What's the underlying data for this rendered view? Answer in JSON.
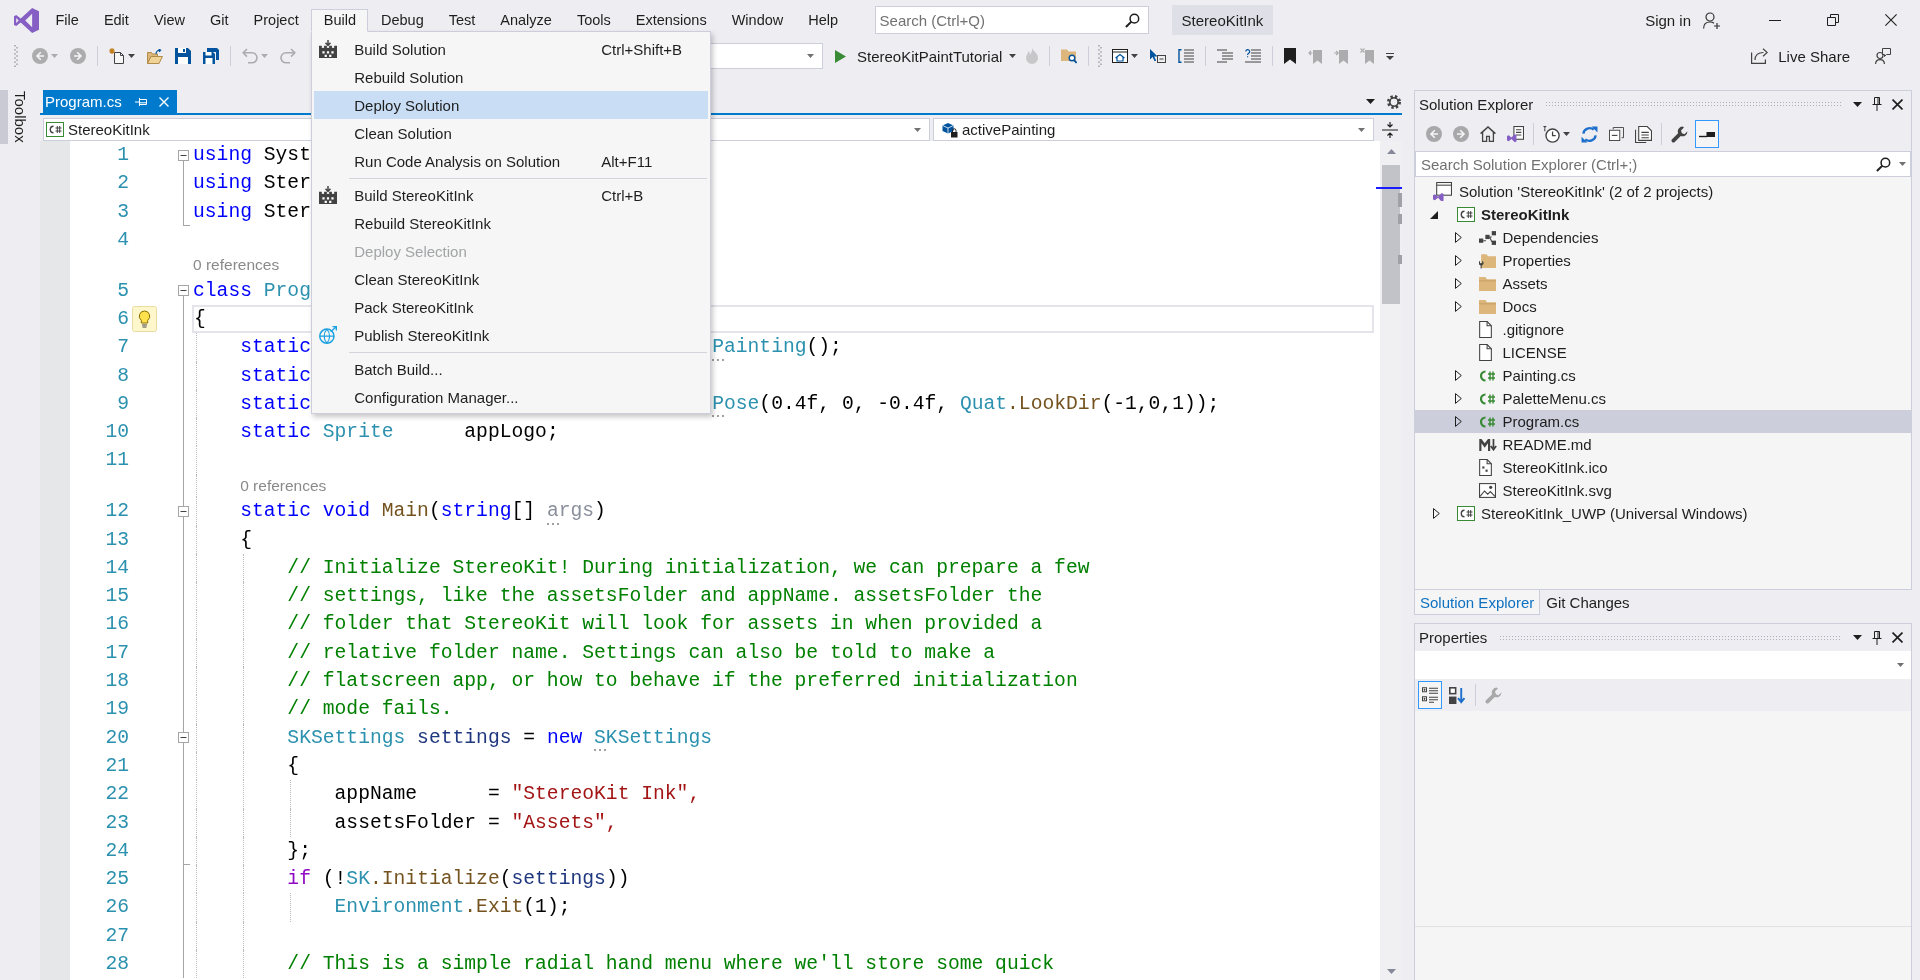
{
  "title_bar": {
    "menu": [
      {
        "label": "File",
        "selected": false
      },
      {
        "label": "Edit",
        "selected": false
      },
      {
        "label": "View",
        "selected": false
      },
      {
        "label": "Git",
        "selected": false
      },
      {
        "label": "Project",
        "selected": false
      },
      {
        "label": "Build",
        "selected": true
      },
      {
        "label": "Debug",
        "selected": false
      },
      {
        "label": "Test",
        "selected": false
      },
      {
        "label": "Analyze",
        "selected": false
      },
      {
        "label": "Tools",
        "selected": false
      },
      {
        "label": "Extensions",
        "selected": false
      },
      {
        "label": "Window",
        "selected": false
      },
      {
        "label": "Help",
        "selected": false
      }
    ],
    "search": {
      "placeholder": "Search (Ctrl+Q)"
    },
    "solution_name": "StereoKitInk",
    "sign_in": "Sign in"
  },
  "build_menu": {
    "items": [
      {
        "kind": "item",
        "label": "Build Solution",
        "shortcut": "Ctrl+Shift+B",
        "selected": false,
        "disabled": false
      },
      {
        "kind": "item",
        "label": "Rebuild Solution",
        "selected": false,
        "disabled": false
      },
      {
        "kind": "item",
        "label": "Deploy Solution",
        "selected": true,
        "disabled": false
      },
      {
        "kind": "item",
        "label": "Clean Solution",
        "selected": false,
        "disabled": false
      },
      {
        "kind": "item",
        "label": "Run Code Analysis on Solution",
        "shortcut": "Alt+F11",
        "selected": false,
        "disabled": false
      },
      {
        "kind": "separator"
      },
      {
        "kind": "item",
        "label": "Build StereoKitInk",
        "shortcut": "Ctrl+B",
        "selected": false,
        "disabled": false
      },
      {
        "kind": "item",
        "label": "Rebuild StereoKitInk",
        "selected": false,
        "disabled": false
      },
      {
        "kind": "item",
        "label": "Deploy Selection",
        "selected": false,
        "disabled": true
      },
      {
        "kind": "item",
        "label": "Clean StereoKitInk",
        "selected": false,
        "disabled": false
      },
      {
        "kind": "item",
        "label": "Pack StereoKitInk",
        "selected": false,
        "disabled": false
      },
      {
        "kind": "item",
        "label": "Publish StereoKitInk",
        "selected": false,
        "disabled": false
      },
      {
        "kind": "separator"
      },
      {
        "kind": "item",
        "label": "Batch Build...",
        "selected": false,
        "disabled": false
      },
      {
        "kind": "item",
        "label": "Configuration Manager...",
        "selected": false,
        "disabled": false
      }
    ]
  },
  "toolbar": {
    "left_buttons": [
      {
        "disabled": true
      },
      {
        "disabled": true
      },
      {
        "disabled": false
      },
      {
        "disabled": false
      },
      {
        "disabled": false
      },
      {
        "disabled": false
      },
      {
        "disabled": true
      },
      {
        "disabled": true
      }
    ],
    "start": {
      "label": "StereoKitPaintTutorial"
    },
    "right_buttons": [
      {
        "disabled": true
      },
      {
        "disabled": false
      },
      {
        "disabled": false
      },
      {
        "disabled": false
      },
      {
        "disabled": false
      },
      {
        "disabled": false
      },
      {
        "disabled": false
      },
      {
        "disabled": false
      },
      {
        "disabled": true
      },
      {
        "disabled": true
      },
      {
        "disabled": true
      },
      {
        "disabled": false
      }
    ],
    "live_share": "Live Share"
  },
  "toolbox": {
    "label": "Toolbox"
  },
  "editor": {
    "tabs": [
      {
        "label": "Program.cs",
        "selected": true
      }
    ],
    "navigation": {
      "project": "StereoKitInk",
      "member": "activePainting"
    },
    "rows": [
      {
        "kind": "code",
        "number": "1",
        "fold_start": true,
        "fold_end": false,
        "lightbulb": false,
        "current": false,
        "tokens": [
          {
            "kind": "keyword",
            "text": "using"
          },
          {
            "kind": "plain",
            "text": " Syst"
          }
        ]
      },
      {
        "kind": "code",
        "number": "2",
        "fold_start": false,
        "fold_end": false,
        "lightbulb": false,
        "current": false,
        "tokens": [
          {
            "kind": "keyword",
            "text": "using"
          },
          {
            "kind": "plain",
            "text": " Ster"
          }
        ]
      },
      {
        "kind": "code",
        "number": "3",
        "fold_start": false,
        "fold_end": true,
        "lightbulb": false,
        "current": false,
        "tokens": [
          {
            "kind": "keyword",
            "text": "using"
          },
          {
            "kind": "plain",
            "text": " Ster"
          }
        ]
      },
      {
        "kind": "code",
        "number": "4",
        "fold_start": false,
        "fold_end": false,
        "lightbulb": false,
        "current": false
      },
      {
        "kind": "codelens",
        "fold_start": false,
        "fold_end": false,
        "lightbulb": false,
        "text": "0 references"
      },
      {
        "kind": "code",
        "number": "5",
        "fold_start": true,
        "fold_end": false,
        "lightbulb": false,
        "current": false,
        "tokens": [
          {
            "kind": "keyword",
            "text": "class "
          },
          {
            "kind": "type",
            "text": "Prog"
          }
        ]
      },
      {
        "kind": "code",
        "number": "6",
        "fold_start": false,
        "fold_end": false,
        "lightbulb": true,
        "current": true,
        "tokens": [
          {
            "kind": "plain",
            "text": "{"
          }
        ]
      },
      {
        "kind": "code",
        "number": "7",
        "fold_start": false,
        "fold_end": false,
        "lightbulb": false,
        "current": false,
        "tokens": [
          {
            "kind": "keyword",
            "text": "    static"
          }
        ],
        "tail": [
          {
            "kind": "hinted",
            "text": "Painting"
          },
          {
            "kind": "plain",
            "text": "();"
          }
        ]
      },
      {
        "kind": "code",
        "number": "8",
        "fold_start": false,
        "fold_end": false,
        "lightbulb": false,
        "current": false,
        "tokens": [
          {
            "kind": "keyword",
            "text": "    static"
          }
        ]
      },
      {
        "kind": "code",
        "number": "9",
        "fold_start": false,
        "fold_end": false,
        "lightbulb": false,
        "current": false,
        "tokens": [
          {
            "kind": "keyword",
            "text": "    static"
          }
        ],
        "tail": [
          {
            "kind": "hinted",
            "text": "Pose"
          },
          {
            "kind": "plain",
            "text": "(0.4f, 0, -0.4f, "
          },
          {
            "kind": "type",
            "text": "Quat"
          },
          {
            "kind": "method",
            "text": ".LookDir"
          },
          {
            "kind": "plain",
            "text": "(-1,0,1));"
          }
        ]
      },
      {
        "kind": "code",
        "number": "10",
        "fold_start": false,
        "fold_end": false,
        "lightbulb": false,
        "current": false,
        "tokens": [
          {
            "kind": "keyword",
            "text": "    static "
          },
          {
            "kind": "type",
            "text": "Sprite"
          },
          {
            "kind": "plain",
            "text": "      appLogo;"
          }
        ]
      },
      {
        "kind": "code",
        "number": "11",
        "fold_start": false,
        "fold_end": false,
        "lightbulb": false,
        "current": false
      },
      {
        "kind": "codelens",
        "fold_start": false,
        "fold_end": false,
        "lightbulb": false,
        "text": "0 references"
      },
      {
        "kind": "code",
        "number": "12",
        "fold_start": true,
        "fold_end": false,
        "lightbulb": false,
        "current": false,
        "tokens": [
          {
            "kind": "keyword",
            "text": "    static void "
          },
          {
            "kind": "method",
            "text": "Main"
          },
          {
            "kind": "plain",
            "text": "("
          },
          {
            "kind": "keyword",
            "text": "string"
          },
          {
            "kind": "plain",
            "text": "[] "
          },
          {
            "kind": "unused",
            "text": "args"
          },
          {
            "kind": "plain",
            "text": ")"
          }
        ]
      },
      {
        "kind": "code",
        "number": "13",
        "fold_start": false,
        "fold_end": false,
        "lightbulb": false,
        "current": false,
        "tokens": [
          {
            "kind": "plain",
            "text": "    {"
          }
        ]
      },
      {
        "kind": "code",
        "number": "14",
        "fold_start": false,
        "fold_end": false,
        "lightbulb": false,
        "current": false,
        "tokens": [
          {
            "kind": "comment",
            "text": "        // Initialize StereoKit! During initialization, we can prepare a few"
          }
        ]
      },
      {
        "kind": "code",
        "number": "15",
        "fold_start": false,
        "fold_end": false,
        "lightbulb": false,
        "current": false,
        "tokens": [
          {
            "kind": "comment",
            "text": "        // settings, like the assetsFolder and appName. assetsFolder the"
          }
        ]
      },
      {
        "kind": "code",
        "number": "16",
        "fold_start": false,
        "fold_end": false,
        "lightbulb": false,
        "current": false,
        "tokens": [
          {
            "kind": "comment",
            "text": "        // folder that StereoKit will look for assets in when provided a"
          }
        ]
      },
      {
        "kind": "code",
        "number": "17",
        "fold_start": false,
        "fold_end": false,
        "lightbulb": false,
        "current": false,
        "tokens": [
          {
            "kind": "comment",
            "text": "        // relative folder name. Settings can also be told to make a"
          }
        ]
      },
      {
        "kind": "code",
        "number": "18",
        "fold_start": false,
        "fold_end": false,
        "lightbulb": false,
        "current": false,
        "tokens": [
          {
            "kind": "comment",
            "text": "        // flatscreen app, or how to behave if the preferred initialization"
          }
        ]
      },
      {
        "kind": "code",
        "number": "19",
        "fold_start": false,
        "fold_end": false,
        "lightbulb": false,
        "current": false,
        "tokens": [
          {
            "kind": "comment",
            "text": "        // mode fails."
          }
        ]
      },
      {
        "kind": "code",
        "number": "20",
        "fold_start": true,
        "fold_end": false,
        "lightbulb": false,
        "current": false,
        "tokens": [
          {
            "kind": "type",
            "text": "        SKSettings"
          },
          {
            "kind": "variable",
            "text": " settings"
          },
          {
            "kind": "plain",
            "text": " = "
          },
          {
            "kind": "keyword",
            "text": "new "
          },
          {
            "kind": "hinted",
            "text": "SKSettings"
          }
        ]
      },
      {
        "kind": "code",
        "number": "21",
        "fold_start": false,
        "fold_end": false,
        "lightbulb": false,
        "current": false,
        "tokens": [
          {
            "kind": "plain",
            "text": "        {"
          }
        ]
      },
      {
        "kind": "code",
        "number": "22",
        "fold_start": false,
        "fold_end": false,
        "lightbulb": false,
        "current": false,
        "tokens": [
          {
            "kind": "plain",
            "text": "            appName      = "
          },
          {
            "kind": "string",
            "text": "\"StereoKit Ink\","
          }
        ]
      },
      {
        "kind": "code",
        "number": "23",
        "fold_start": false,
        "fold_end": false,
        "lightbulb": false,
        "current": false,
        "tokens": [
          {
            "kind": "plain",
            "text": "            assetsFolder = "
          },
          {
            "kind": "string",
            "text": "\"Assets\","
          }
        ]
      },
      {
        "kind": "code",
        "number": "24",
        "fold_start": false,
        "fold_end": true,
        "lightbulb": false,
        "current": false,
        "tokens": [
          {
            "kind": "plain",
            "text": "        };"
          }
        ]
      },
      {
        "kind": "code",
        "number": "25",
        "fold_start": false,
        "fold_end": false,
        "lightbulb": false,
        "current": false,
        "tokens": [
          {
            "kind": "control",
            "text": "        if"
          },
          {
            "kind": "plain",
            "text": " (!"
          },
          {
            "kind": "type",
            "text": "SK"
          },
          {
            "kind": "method",
            "text": ".Initialize"
          },
          {
            "kind": "plain",
            "text": "("
          },
          {
            "kind": "variable",
            "text": "settings"
          },
          {
            "kind": "plain",
            "text": "))"
          }
        ]
      },
      {
        "kind": "code",
        "number": "26",
        "fold_start": false,
        "fold_end": false,
        "lightbulb": false,
        "current": false,
        "tokens": [
          {
            "kind": "type",
            "text": "            Environment"
          },
          {
            "kind": "method",
            "text": ".Exit"
          },
          {
            "kind": "plain",
            "text": "(1);"
          }
        ]
      },
      {
        "kind": "code",
        "number": "27",
        "fold_start": false,
        "fold_end": false,
        "lightbulb": false,
        "current": false
      },
      {
        "kind": "code",
        "number": "28",
        "fold_start": false,
        "fold_end": false,
        "lightbulb": false,
        "current": false,
        "tokens": [
          {
            "kind": "comment",
            "text": "        // This is a simple radial hand menu where we'll store some quick"
          }
        ]
      }
    ]
  },
  "solution_explorer": {
    "title": "Solution Explorer",
    "toolbar": [
      {
        "selected": false,
        "disabled": true
      },
      {
        "selected": false,
        "disabled": true
      },
      {
        "selected": false,
        "disabled": false
      },
      {
        "selected": false,
        "disabled": false
      },
      {
        "selected": false,
        "disabled": false
      },
      {
        "selected": false,
        "disabled": false
      },
      {
        "selected": false,
        "disabled": false
      },
      {
        "selected": false,
        "disabled": false
      },
      {
        "selected": false,
        "disabled": false
      },
      {
        "selected": true,
        "disabled": false
      }
    ],
    "search": {
      "placeholder": "Search Solution Explorer (Ctrl+;)"
    },
    "tree": [
      {
        "label": "Solution 'StereoKitInk' (2 of 2 projects)",
        "kind": "solution",
        "selected": false,
        "children": [
          {
            "label": "StereoKitInk",
            "kind": "project",
            "startup": true,
            "expanded": true,
            "selected": false,
            "children": [
              {
                "label": "Dependencies",
                "kind": "dependencies",
                "expanded": false,
                "selected": false
              },
              {
                "label": "Properties",
                "kind": "properties",
                "expanded": false,
                "selected": false
              },
              {
                "label": "Assets",
                "kind": "folder",
                "expanded": false,
                "selected": false
              },
              {
                "label": "Docs",
                "kind": "folder",
                "expanded": false,
                "selected": false
              },
              {
                "label": ".gitignore",
                "kind": "text",
                "selected": false
              },
              {
                "label": "LICENSE",
                "kind": "text",
                "selected": false
              },
              {
                "label": "Painting.cs",
                "kind": "csharp",
                "expanded": false,
                "selected": false
              },
              {
                "label": "PaletteMenu.cs",
                "kind": "csharp",
                "expanded": false,
                "selected": false
              },
              {
                "label": "Program.cs",
                "kind": "csharp",
                "expanded": false,
                "selected": true
              },
              {
                "label": "README.md",
                "kind": "markdown",
                "selected": false
              },
              {
                "label": "StereoKitInk.ico",
                "kind": "iconfile",
                "selected": false
              },
              {
                "label": "StereoKitInk.svg",
                "kind": "image",
                "selected": false
              }
            ]
          },
          {
            "label": "StereoKitInk_UWP (Universal Windows)",
            "kind": "project",
            "startup": false,
            "expanded": false,
            "selected": false
          }
        ]
      }
    ]
  },
  "tool_tabs": [
    {
      "label": "Solution Explorer",
      "selected": true
    },
    {
      "label": "Git Changes",
      "selected": false
    }
  ],
  "properties": {
    "title": "Properties",
    "toolbar": [
      {
        "selected": true,
        "disabled": false
      },
      {
        "selected": false,
        "disabled": false
      },
      {
        "selected": false,
        "disabled": true
      }
    ]
  }
}
